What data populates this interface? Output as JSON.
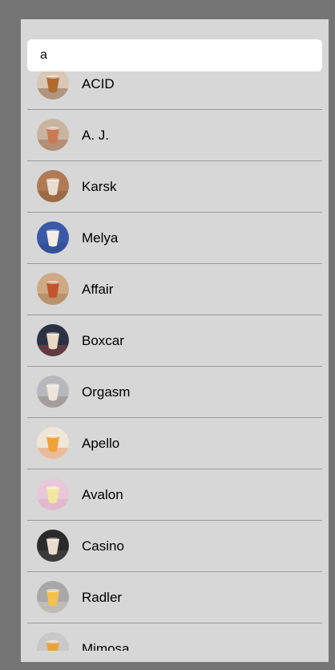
{
  "search": {
    "value": "a"
  },
  "drinks": [
    {
      "name": "ACID",
      "bg": "#d9c7b5",
      "glass": "#b06a2a",
      "accent": "#6b3a1a"
    },
    {
      "name": "A. J.",
      "bg": "#c9b4a0",
      "glass": "#c97a52",
      "accent": "#8a4a2e"
    },
    {
      "name": "Karsk",
      "bg": "#b07a55",
      "glass": "#e8dccf",
      "accent": "#7a4a2a"
    },
    {
      "name": "Melya",
      "bg": "#3a5aa8",
      "glass": "#f3ede2",
      "accent": "#2a3e80"
    },
    {
      "name": "Affair",
      "bg": "#cfa884",
      "glass": "#c2552e",
      "accent": "#8a6a3a"
    },
    {
      "name": "Boxcar",
      "bg": "#2c3244",
      "glass": "#e8d9c4",
      "accent": "#c24a3a"
    },
    {
      "name": "Orgasm",
      "bg": "#b8b8bc",
      "glass": "#ece6dc",
      "accent": "#7c6e64"
    },
    {
      "name": "Apello",
      "bg": "#f0e6d8",
      "glass": "#f0a23a",
      "accent": "#e06a2a"
    },
    {
      "name": "Avalon",
      "bg": "#e8c8d8",
      "glass": "#f2e7a0",
      "accent": "#d89ab8"
    },
    {
      "name": "Casino",
      "bg": "#2a2a2a",
      "glass": "#e8dccc",
      "accent": "#5a5a5a"
    },
    {
      "name": "Radler",
      "bg": "#a8a8a8",
      "glass": "#f2c24a",
      "accent": "#e8e2d0"
    },
    {
      "name": "Mimosa",
      "bg": "#c8c8c8",
      "glass": "#e8a23a",
      "accent": "#6a7a8a"
    }
  ]
}
